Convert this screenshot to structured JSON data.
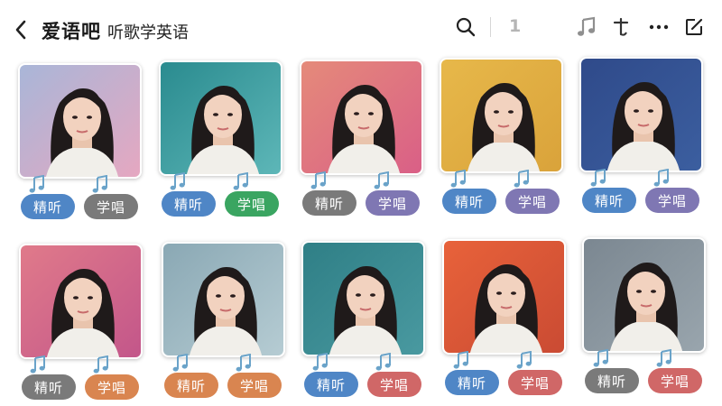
{
  "header": {
    "title": "爱语吧",
    "subtitle": "听歌学英语",
    "count": "1"
  },
  "colors": {
    "blue": "#4f86c6",
    "gray": "#7a7a7a",
    "purple": "#7f77b3",
    "green": "#3aa561",
    "orange": "#d98550",
    "red": "#d06767",
    "note_blue": "#6aa3c9"
  },
  "cards": [
    {
      "listen": "精听",
      "sing": "学唱",
      "listen_color": "blue",
      "sing_color": "gray",
      "bg": [
        "#a9b6d8",
        "#e7a7c0"
      ]
    },
    {
      "listen": "精听",
      "sing": "学唱",
      "listen_color": "blue",
      "sing_color": "green",
      "bg": [
        "#2a8b8f",
        "#5fb8b9"
      ]
    },
    {
      "listen": "精听",
      "sing": "学唱",
      "listen_color": "gray",
      "sing_color": "purple",
      "bg": [
        "#e58a7a",
        "#d95e87"
      ]
    },
    {
      "listen": "精听",
      "sing": "学唱",
      "listen_color": "blue",
      "sing_color": "purple",
      "bg": [
        "#e7b84a",
        "#d9a23a"
      ]
    },
    {
      "listen": "精听",
      "sing": "学唱",
      "listen_color": "blue",
      "sing_color": "purple",
      "bg": [
        "#2f4a8a",
        "#3c5fa0"
      ]
    },
    {
      "listen": "精听",
      "sing": "学唱",
      "listen_color": "gray",
      "sing_color": "orange",
      "bg": [
        "#e07a8a",
        "#c2558a"
      ]
    },
    {
      "listen": "精听",
      "sing": "学唱",
      "listen_color": "orange",
      "sing_color": "orange",
      "bg": [
        "#8aa8b4",
        "#b7cdd4"
      ]
    },
    {
      "listen": "精听",
      "sing": "学唱",
      "listen_color": "blue",
      "sing_color": "red",
      "bg": [
        "#2f7f86",
        "#4a9aa1"
      ]
    },
    {
      "listen": "精听",
      "sing": "学唱",
      "listen_color": "blue",
      "sing_color": "red",
      "bg": [
        "#e8623a",
        "#c94a33"
      ]
    },
    {
      "listen": "精听",
      "sing": "学唱",
      "listen_color": "gray",
      "sing_color": "red",
      "bg": [
        "#7b8791",
        "#9aa6ae"
      ]
    }
  ]
}
